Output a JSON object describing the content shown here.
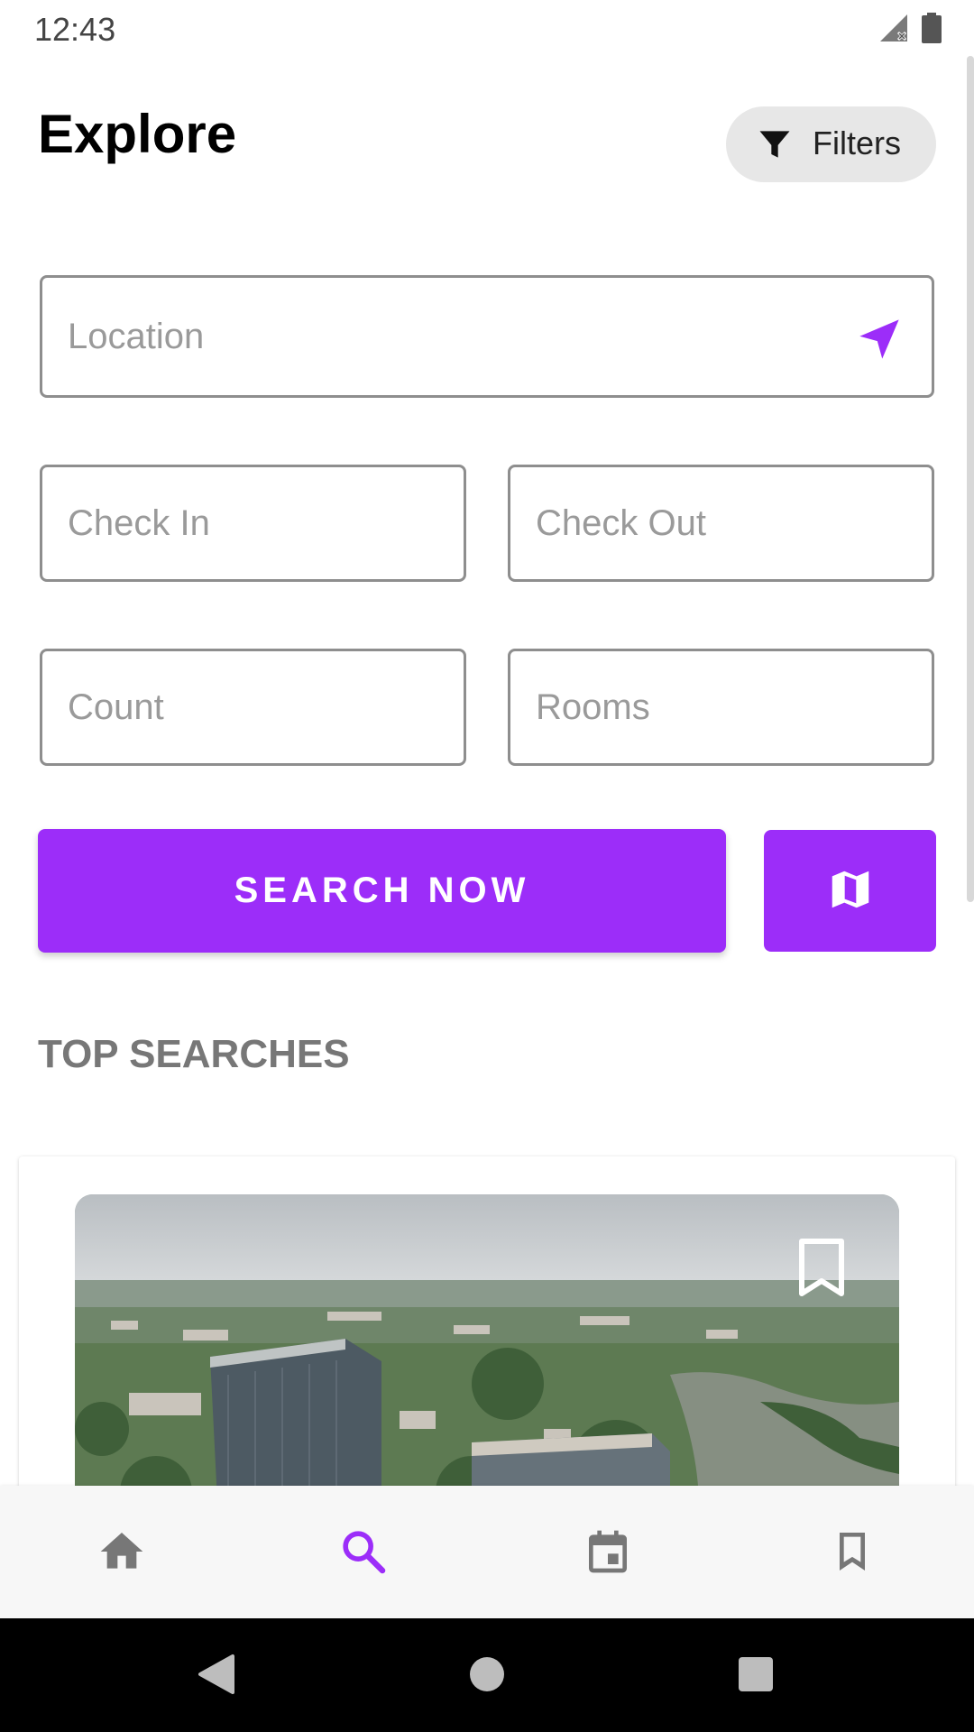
{
  "status_bar": {
    "time": "12:43"
  },
  "header": {
    "title": "Explore",
    "filters_label": "Filters"
  },
  "form": {
    "location_placeholder": "Location",
    "check_in_placeholder": "Check In",
    "check_out_placeholder": "Check Out",
    "count_placeholder": "Count",
    "rooms_placeholder": "Rooms",
    "search_label": "SEARCH NOW"
  },
  "top_searches": {
    "title": "TOP SEARCHES"
  },
  "icons": {
    "filter": "filter-icon",
    "location": "navigation-arrow-icon",
    "map": "map-icon",
    "bookmark": "bookmark-outline-icon",
    "home": "home-icon",
    "search": "search-icon",
    "calendar": "calendar-icon",
    "saved": "bookmark-icon"
  },
  "colors": {
    "accent": "#9c2df9",
    "nav_inactive": "#777777",
    "field_border": "#8e8e8e",
    "section_title": "#777777"
  },
  "bottom_nav": {
    "active": "search"
  }
}
